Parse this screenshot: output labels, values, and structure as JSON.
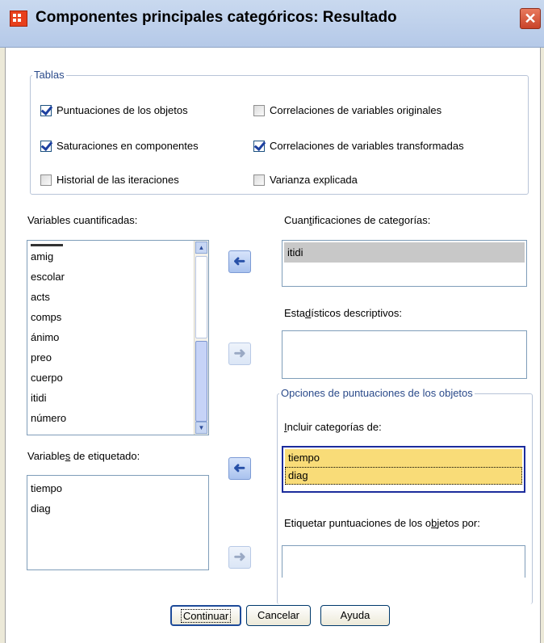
{
  "window": {
    "title": "Componentes principales categóricos: Resultado",
    "close_glyph": "✕"
  },
  "tables": {
    "legend": "Tablas",
    "items": [
      {
        "label": "Puntuaciones de los objetos",
        "checked": true
      },
      {
        "label": "Saturaciones en componentes",
        "checked": true
      },
      {
        "label": "Historial de las iteraciones",
        "checked": false
      },
      {
        "label": "Correlaciones de variables originales",
        "checked": false
      },
      {
        "label": "Correlaciones de variables transformadas",
        "checked": true
      },
      {
        "label": "Varianza explicada",
        "checked": false
      }
    ]
  },
  "quantified_vars": {
    "label": "Variables cuantificadas:",
    "items": [
      "amig",
      "escolar",
      "acts",
      "comps",
      "ánimo",
      "preo",
      "cuerpo",
      "itidi",
      "número"
    ]
  },
  "labeling_vars": {
    "label": "Variables de etiquetado:",
    "items": [
      "tiempo",
      "diag"
    ]
  },
  "category_quant": {
    "label": "Cuantificaciones de categorías:",
    "items": [
      "itidi"
    ]
  },
  "descriptive": {
    "label": "Estadísticos descriptivos:"
  },
  "object_scores": {
    "legend": "Opciones de puntuaciones de los objetos",
    "include_label": "Incluir categorías de:",
    "include_items": [
      "tiempo",
      "diag"
    ],
    "tag_label": "Etiquetar puntuaciones de los objetos por:"
  },
  "buttons": {
    "continue": "Continuar",
    "cancel": "Cancelar",
    "help": "Ayuda"
  },
  "arrows": {
    "move": "➜"
  },
  "colors": {
    "selection_yellow": "#f9dc78",
    "selection_gray": "#c8c8c8",
    "group_legend": "#2a4a8a"
  }
}
